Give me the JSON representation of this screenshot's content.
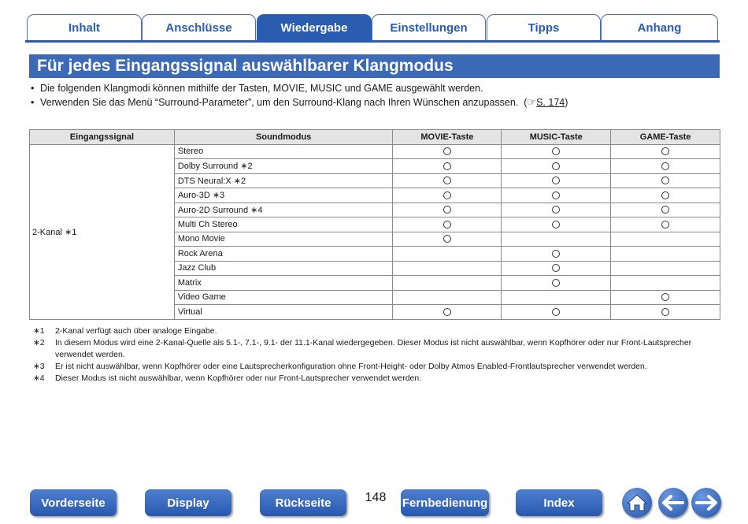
{
  "tabs": [
    {
      "label": "Inhalt",
      "active": false
    },
    {
      "label": "Anschlüsse",
      "active": false
    },
    {
      "label": "Wiedergabe",
      "active": true
    },
    {
      "label": "Einstellungen",
      "active": false
    },
    {
      "label": "Tipps",
      "active": false
    },
    {
      "label": "Anhang",
      "active": false
    }
  ],
  "heading": "Für jedes Eingangssignal auswählbarer Klangmodus",
  "bullets": [
    "Die folgenden Klangmodi können mithilfe der Tasten, MOVIE, MUSIC und GAME ausgewählt werden.",
    "Verwenden Sie das Menü “Surround-Parameter”, um den Surround-Klang nach Ihren Wünschen anzupassen."
  ],
  "bullet_ref": {
    "open": "(",
    "icon": "☞",
    "link": "S. 174",
    "close": ")"
  },
  "table": {
    "headers": [
      "Eingangssignal",
      "Soundmodus",
      "MOVIE-Taste",
      "MUSIC-Taste",
      "GAME-Taste"
    ],
    "signal": "2-Kanal ∗1",
    "rows": [
      {
        "mode": "Stereo",
        "movie": true,
        "music": true,
        "game": true
      },
      {
        "mode": "Dolby Surround ∗2",
        "movie": true,
        "music": true,
        "game": true
      },
      {
        "mode": "DTS Neural:X ∗2",
        "movie": true,
        "music": true,
        "game": true
      },
      {
        "mode": "Auro-3D ∗3",
        "movie": true,
        "music": true,
        "game": true
      },
      {
        "mode": "Auro-2D Surround ∗4",
        "movie": true,
        "music": true,
        "game": true
      },
      {
        "mode": "Multi Ch Stereo",
        "movie": true,
        "music": true,
        "game": true
      },
      {
        "mode": "Mono Movie",
        "movie": true,
        "music": false,
        "game": false
      },
      {
        "mode": "Rock Arena",
        "movie": false,
        "music": true,
        "game": false
      },
      {
        "mode": "Jazz Club",
        "movie": false,
        "music": true,
        "game": false
      },
      {
        "mode": "Matrix",
        "movie": false,
        "music": true,
        "game": false
      },
      {
        "mode": "Video Game",
        "movie": false,
        "music": false,
        "game": true
      },
      {
        "mode": "Virtual",
        "movie": true,
        "music": true,
        "game": true
      }
    ]
  },
  "footnotes": [
    {
      "mark": "∗1",
      "text": "2-Kanal verfügt auch über analoge Eingabe."
    },
    {
      "mark": "∗2",
      "text": "In diesem Modus wird eine 2-Kanal-Quelle als 5.1-, 7.1-, 9.1- der 11.1-Kanal wiedergegeben. Dieser Modus ist nicht auswählbar, wenn Kopfhörer oder nur Front-Lautsprecher verwendet werden."
    },
    {
      "mark": "∗3",
      "text": "Er ist nicht auswählbar, wenn Kopfhörer oder eine Lautsprecherkonfiguration ohne Front-Height- oder Dolby Atmos Enabled-Frontlautsprecher verwendet werden."
    },
    {
      "mark": "∗4",
      "text": "Dieser Modus ist nicht auswählbar, wenn Kopfhörer oder nur Front-Lautsprecher verwendet werden."
    }
  ],
  "footer": {
    "buttons": [
      "Vorderseite",
      "Display",
      "Rückseite",
      "Fernbedienung",
      "Index"
    ],
    "page_number": "148",
    "icons": [
      "home-icon",
      "arrow-left-icon",
      "arrow-right-icon"
    ]
  },
  "colors": {
    "accent": "#2a5db0",
    "heading_bg": "#3d6ab7",
    "table_header_bg": "#e4e4e4"
  }
}
